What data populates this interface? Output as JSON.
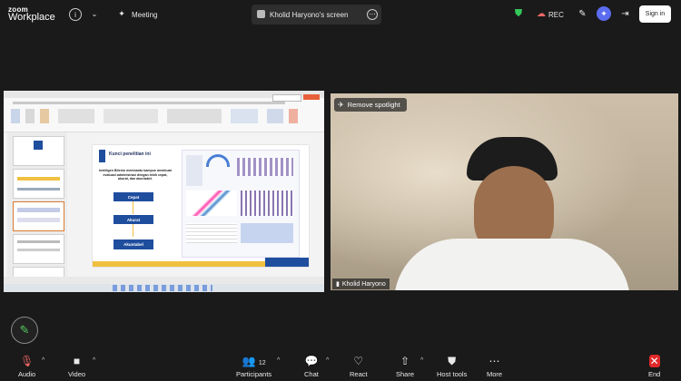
{
  "app": {
    "brand_top": "zoom",
    "brand_bottom": "Workplace"
  },
  "header": {
    "meeting_label": "Meeting",
    "screen_title": "Kholid Haryono's screen",
    "rec_label": "REC",
    "signin_label": "Sign in"
  },
  "slide": {
    "title": "Kunci penelitian ini",
    "desc": "Intelligen Bitenio membantu kampus membuat evaluasi administrasi dengan lebih cepat, akurat, dan akuntabel.",
    "steps": [
      "Cepat",
      "Akurat",
      "Akuntabel"
    ]
  },
  "video": {
    "spotlight_label": "Remove spotlight",
    "participant_name": "Kholid Haryono"
  },
  "toolbar": {
    "audio": "Audio",
    "video": "Video",
    "participants": "Participants",
    "participants_count": "12",
    "chat": "Chat",
    "react": "React",
    "share": "Share",
    "host_tools": "Host tools",
    "more": "More",
    "end": "End"
  },
  "colors": {
    "accent": "#1f4e9e",
    "end_red": "#e02828",
    "shield_green": "#34c759",
    "pen_green": "#55c85f"
  }
}
